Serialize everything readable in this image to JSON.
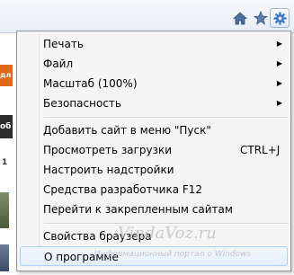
{
  "toolbar": {
    "icons": [
      "home-icon",
      "star-icon",
      "gear-icon"
    ],
    "accent_color": "#3c78c8"
  },
  "background_page": {
    "orange_tab_text": "дл",
    "dark_block_text": "об",
    "number_text": "1"
  },
  "menu": {
    "items": [
      {
        "label": "Печать",
        "submenu": true
      },
      {
        "label": "Файл",
        "submenu": true
      },
      {
        "label": "Масштаб (100%)",
        "submenu": true
      },
      {
        "label": "Безопасность",
        "submenu": true
      },
      {
        "label": "Добавить сайт в меню \"Пуск\""
      },
      {
        "label": "Просмотреть загрузки",
        "shortcut": "CTRL+J"
      },
      {
        "label": "Настроить надстройки"
      },
      {
        "label": "Средства разработчика F12"
      },
      {
        "label": "Перейти к закрепленным сайтам"
      },
      {
        "label": "Свойства браузера"
      },
      {
        "label": "О программе"
      }
    ],
    "submenu_arrow": "▶"
  },
  "watermark": {
    "site": "VindaVoz.ru",
    "tagline": "Информационный портал о Windows"
  }
}
